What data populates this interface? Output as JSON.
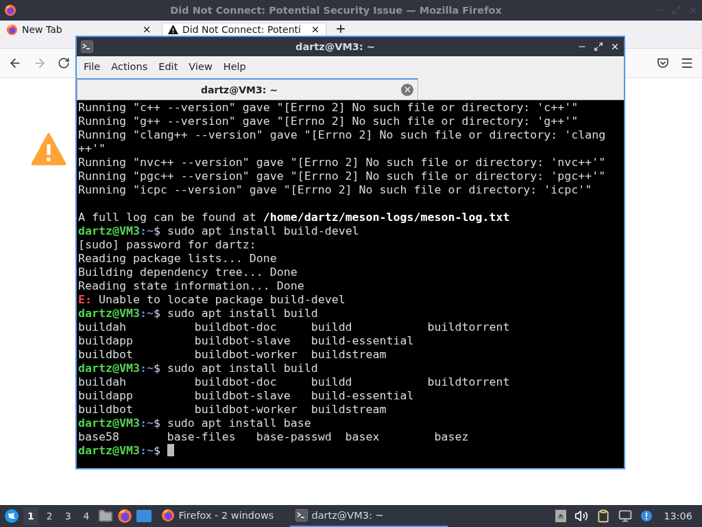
{
  "firefox": {
    "title": "Did Not Connect: Potential Security Issue — Mozilla Firefox",
    "tabs": [
      {
        "kind": "newtab",
        "label": "New Tab",
        "selected": false
      },
      {
        "kind": "error",
        "label": "Did Not Connect: Potenti",
        "selected": true
      }
    ]
  },
  "terminal": {
    "title": "dartz@VM3: ~",
    "menu": [
      "File",
      "Actions",
      "Edit",
      "View",
      "Help"
    ],
    "tabs": [
      {
        "label": "dartz@VM3: ~",
        "selected": true
      }
    ],
    "lines": [
      {
        "kind": "output",
        "text": "Running \"c++ --version\" gave \"[Errno 2] No such file or directory: 'c++'\""
      },
      {
        "kind": "output",
        "text": "Running \"g++ --version\" gave \"[Errno 2] No such file or directory: 'g++'\""
      },
      {
        "kind": "output",
        "text": "Running \"clang++ --version\" gave \"[Errno 2] No such file or directory: 'clang"
      },
      {
        "kind": "output",
        "text": "++'\""
      },
      {
        "kind": "output",
        "text": "Running \"nvc++ --version\" gave \"[Errno 2] No such file or directory: 'nvc++'\""
      },
      {
        "kind": "output",
        "text": "Running \"pgc++ --version\" gave \"[Errno 2] No such file or directory: 'pgc++'\""
      },
      {
        "kind": "output",
        "text": "Running \"icpc --version\" gave \"[Errno 2] No such file or directory: 'icpc'\""
      },
      {
        "kind": "blank"
      },
      {
        "kind": "log",
        "text": "A full log can be found at",
        "path": "/home/dartz/meson-logs/meson-log.txt"
      },
      {
        "kind": "prompt",
        "user": "dartz@VM3",
        "path": ":~",
        "text": "$ sudo apt install build-devel",
        "cursor": false
      },
      {
        "kind": "output",
        "text": "[sudo] password for dartz:"
      },
      {
        "kind": "output",
        "text": "Reading package lists... Done"
      },
      {
        "kind": "output",
        "text": "Building dependency tree... Done"
      },
      {
        "kind": "output",
        "text": "Reading state information... Done"
      },
      {
        "kind": "error",
        "tag": "E:",
        "text": " Unable to locate package build-devel"
      },
      {
        "kind": "prompt",
        "user": "dartz@VM3",
        "path": ":~",
        "text": "$ sudo apt install build",
        "cursor": false
      },
      {
        "kind": "output",
        "text": "buildah          buildbot-doc     buildd           buildtorrent"
      },
      {
        "kind": "output",
        "text": "buildapp         buildbot-slave   build-essential"
      },
      {
        "kind": "output",
        "text": "buildbot         buildbot-worker  buildstream"
      },
      {
        "kind": "prompt",
        "user": "dartz@VM3",
        "path": ":~",
        "text": "$ sudo apt install build",
        "cursor": false
      },
      {
        "kind": "output",
        "text": "buildah          buildbot-doc     buildd           buildtorrent"
      },
      {
        "kind": "output",
        "text": "buildapp         buildbot-slave   build-essential"
      },
      {
        "kind": "output",
        "text": "buildbot         buildbot-worker  buildstream"
      },
      {
        "kind": "prompt",
        "user": "dartz@VM3",
        "path": ":~",
        "text": "$ sudo apt install base",
        "cursor": false
      },
      {
        "kind": "output",
        "text": "base58       base-files   base-passwd  basex        basez"
      },
      {
        "kind": "prompt",
        "user": "dartz@VM3",
        "path": ":~",
        "text": "$",
        "cursor": true
      }
    ]
  },
  "taskbar": {
    "desktops": [
      {
        "label": "1",
        "selected": true
      },
      {
        "label": "2",
        "selected": false
      },
      {
        "label": "3",
        "selected": false
      },
      {
        "label": "4",
        "selected": false
      }
    ],
    "tasks": [
      {
        "kind": "firefox",
        "label": "Firefox - 2 windows",
        "selected": false
      },
      {
        "kind": "terminal",
        "label": "dartz@VM3: ~",
        "selected": true
      }
    ],
    "clock": "13:06"
  }
}
